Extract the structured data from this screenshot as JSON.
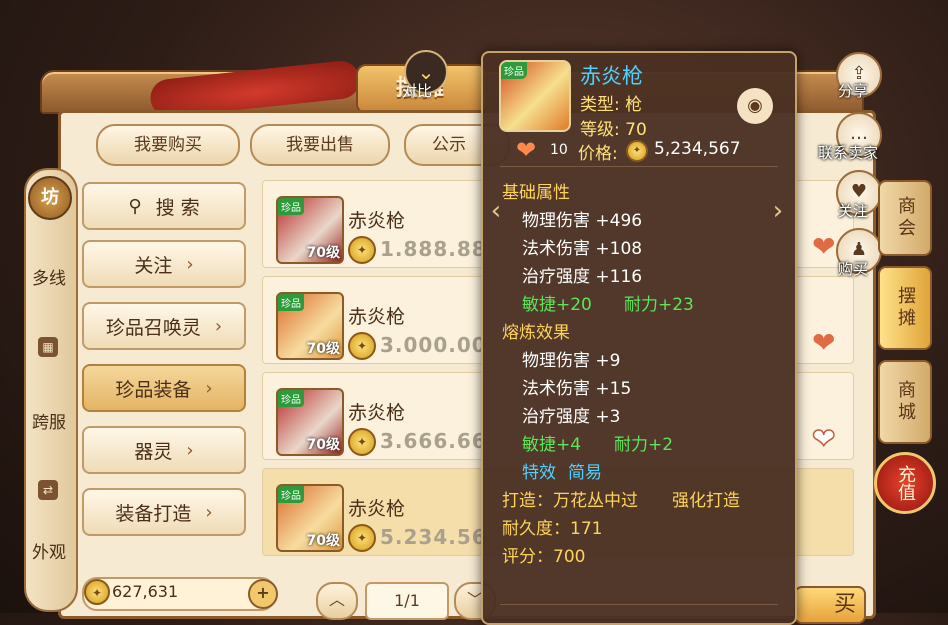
{
  "stall_title": "摆摊",
  "compare": {
    "label": "对比",
    "icon": "chevron-down-icon"
  },
  "tabs": [
    "我要购买",
    "我要出售",
    "公示"
  ],
  "left_nav": {
    "top_label": "坊",
    "items": [
      {
        "label": "多线"
      },
      {
        "label": "跨服"
      },
      {
        "label": "外观"
      }
    ]
  },
  "categories": [
    {
      "label": "搜 索",
      "icon": "search-icon"
    },
    {
      "label": "关注"
    },
    {
      "label": "珍品召唤灵"
    },
    {
      "label": "珍品装备",
      "active": true
    },
    {
      "label": "器灵"
    },
    {
      "label": "装备打造"
    }
  ],
  "listings": [
    {
      "name": "赤炎枪",
      "tag": "珍品",
      "level": "70级",
      "price": "1.888.88",
      "style": "red"
    },
    {
      "name": "赤炎枪",
      "tag": "珍品",
      "level": "70级",
      "price": "3.000.00",
      "style": "gold"
    },
    {
      "name": "赤炎枪",
      "tag": "珍品",
      "level": "70级",
      "price": "3.666.66",
      "style": "red"
    },
    {
      "name": "赤炎枪",
      "tag": "珍品",
      "level": "70级",
      "price": "5.234.56",
      "style": "gold"
    }
  ],
  "wallet": {
    "value": "627,631",
    "plus": "+"
  },
  "pager": {
    "text": "1/1"
  },
  "side_actions": [
    {
      "label": "分享",
      "icon": "share-icon"
    },
    {
      "label": "联系卖家",
      "icon": "chat-icon"
    },
    {
      "label": "关注",
      "icon": "heart-icon"
    },
    {
      "label": "购买",
      "icon": "buy-icon"
    }
  ],
  "right_nav": [
    "商会",
    "摆摊",
    "商城"
  ],
  "recharge": "充值",
  "tooltip": {
    "tag": "珍品",
    "name": "赤炎枪",
    "type": "类型: 枪",
    "level": "等级: 70",
    "fav_count": "10",
    "price_label": "价格:",
    "price": "5,234,567",
    "base_title": "基础属性",
    "base_attrs": [
      "物理伤害 +496",
      "法术伤害 +108",
      "治疗强度 +116"
    ],
    "base_extra": [
      "敏捷+20",
      "耐力+23"
    ],
    "refine_title": "熔炼效果",
    "refine_attrs": [
      "物理伤害 +9",
      "法术伤害 +15",
      "治疗强度 +3"
    ],
    "refine_extra": [
      "敏捷+4",
      "耐力+2"
    ],
    "special_label": "特效",
    "special_value": "简易",
    "forge": "打造：万花丛中过",
    "enhance": "强化打造",
    "durability": "耐久度：171",
    "score": "评分：700"
  },
  "buy_button_partial": "买",
  "colors": {
    "accent_gold": "#ffd35a",
    "name_blue": "#4fd1ff",
    "green": "#5fe35a",
    "panel": "#f6ead2"
  }
}
